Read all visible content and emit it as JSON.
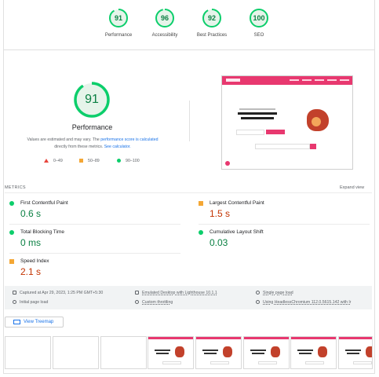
{
  "scores": [
    {
      "label": "Performance",
      "value": "91"
    },
    {
      "label": "Accessibility",
      "value": "96"
    },
    {
      "label": "Best Practices",
      "value": "92"
    },
    {
      "label": "SEO",
      "value": "100"
    }
  ],
  "performance": {
    "score": "91",
    "score_fraction": 0.91,
    "title": "Performance",
    "desc_part1": "Values are estimated and may vary. The ",
    "desc_link1": "performance score is calculated",
    "desc_part2": "directly from these metrics. ",
    "desc_link2": "See calculator.",
    "legend": [
      {
        "range": "0–49",
        "color": "#e8453c"
      },
      {
        "range": "50–89",
        "color": "#f4a735"
      },
      {
        "range": "90–100",
        "color": "#0cce6b"
      }
    ]
  },
  "colors": {
    "good": "#0cce6b",
    "good_text": "#0b8043",
    "average": "#f4a735",
    "poor": "#e8453c",
    "link": "#1a73e8"
  },
  "metrics": {
    "heading": "METRICS",
    "expand_label": "Expand view",
    "items": [
      {
        "name": "First Contentful Paint",
        "value": "0.6 s",
        "status": "good"
      },
      {
        "name": "Largest Contentful Paint",
        "value": "1.5 s",
        "status": "average"
      },
      {
        "name": "Total Blocking Time",
        "value": "0 ms",
        "status": "good"
      },
      {
        "name": "Cumulative Layout Shift",
        "value": "0.03",
        "status": "good"
      },
      {
        "name": "Speed Index",
        "value": "2.1 s",
        "status": "average"
      }
    ]
  },
  "runtime": {
    "captured": "Captured at Apr 29, 2023, 1:25 PM GMT+5:30",
    "emulated": "Emulated Desktop with Lighthouse 10.1.1",
    "single_load": "Single page load",
    "initial_load": "Initial page load",
    "throttling": "Custom throttling",
    "browser": "Using HeadlessChromium 112.0.5615.142 with lr"
  },
  "treemap_label": "View Treemap",
  "screenshot": {
    "headline": "The Largest Curator of Lifetime Tech Deals on This Planet"
  }
}
